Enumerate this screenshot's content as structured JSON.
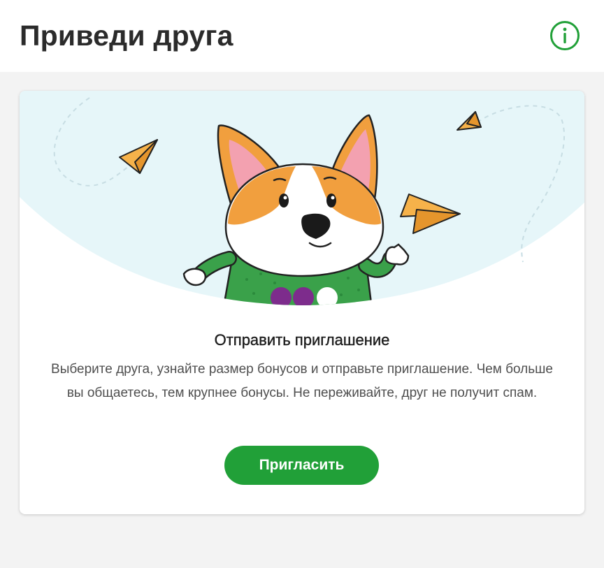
{
  "header": {
    "title": "Приведи друга",
    "info_icon": "info-circle-icon",
    "accent_color": "#21a038"
  },
  "card": {
    "illustration": "corgi-with-paper-planes",
    "title": "Отправить приглашение",
    "text": "Выберите друга, узнайте размер бонусов и отправьте приглашение. Чем больше вы общаетесь, тем крупнее бонусы. Не переживайте, друг не получит спам.",
    "button_label": "Пригласить",
    "button_color": "#21a038"
  }
}
